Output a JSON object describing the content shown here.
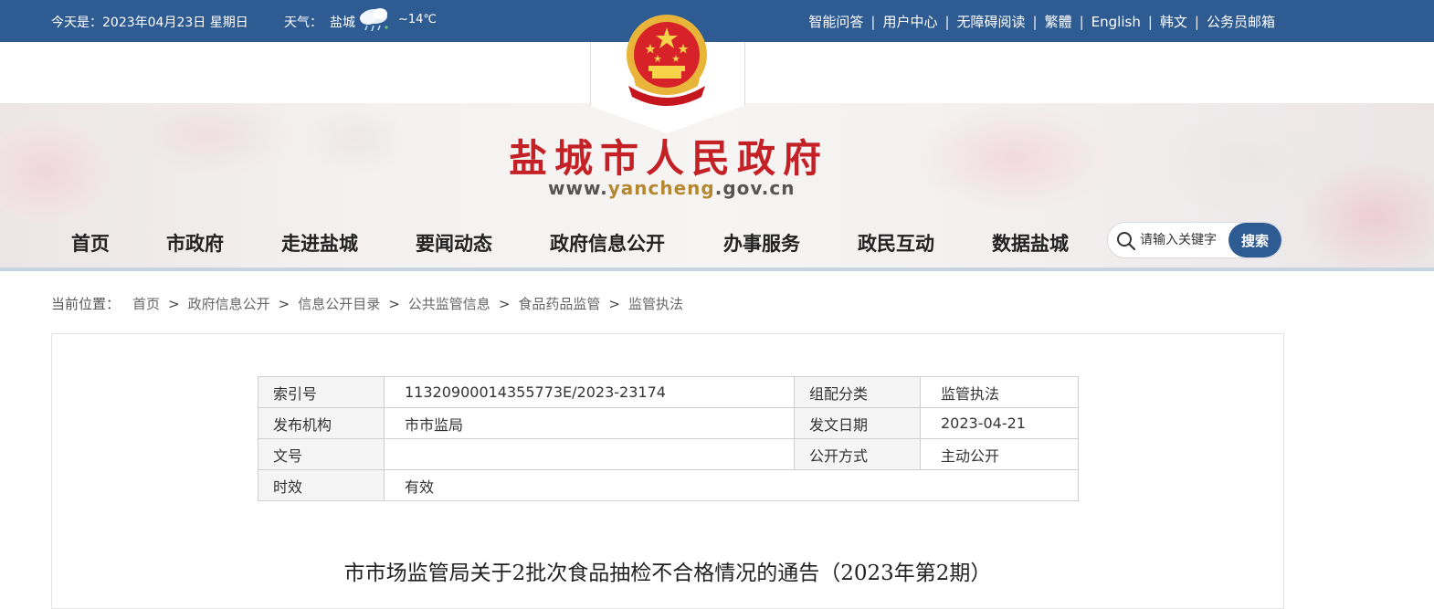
{
  "topbar": {
    "date": "今天是：2023年04月23日 星期日",
    "weather_label": "天气：",
    "weather_city": "盐城",
    "weather_icon": "rain-cloud-icon",
    "weather_temp": "~14℃",
    "links": [
      "智能问答",
      "用户中心",
      "无障碍阅读",
      "繁體",
      "English",
      "韩文",
      "公务员邮箱"
    ],
    "bg_color": "#2f5b93"
  },
  "header": {
    "emblem": "national-emblem-icon",
    "title": "盐城市人民政府",
    "url_prefix": "www.",
    "url_highlight": "yancheng",
    "url_suffix": ".gov.cn",
    "title_color": "#c42127"
  },
  "nav": {
    "items": [
      "首页",
      "市政府",
      "走进盐城",
      "要闻动态",
      "政府信息公开",
      "办事服务",
      "政民互动",
      "数据盐城"
    ],
    "search_placeholder": "请输入关键字",
    "search_button": "搜索"
  },
  "breadcrumb": {
    "label": "当前位置：",
    "items": [
      "首页",
      "政府信息公开",
      "信息公开目录",
      "公共监管信息",
      "食品药品监管",
      "监管执法"
    ]
  },
  "meta": {
    "index_label": "索引号",
    "index_value": "11320900014355773E/2023-23174",
    "category_label": "组配分类",
    "category_value": "监管执法",
    "publisher_label": "发布机构",
    "publisher_value": "市市监局",
    "date_label": "发文日期",
    "date_value": "2023-04-21",
    "docno_label": "文号",
    "docno_value": "",
    "disclosure_label": "公开方式",
    "disclosure_value": "主动公开",
    "validity_label": "时效",
    "validity_value": "有效"
  },
  "article": {
    "title": "市市场监管局关于2批次食品抽检不合格情况的通告（2023年第2期）"
  }
}
